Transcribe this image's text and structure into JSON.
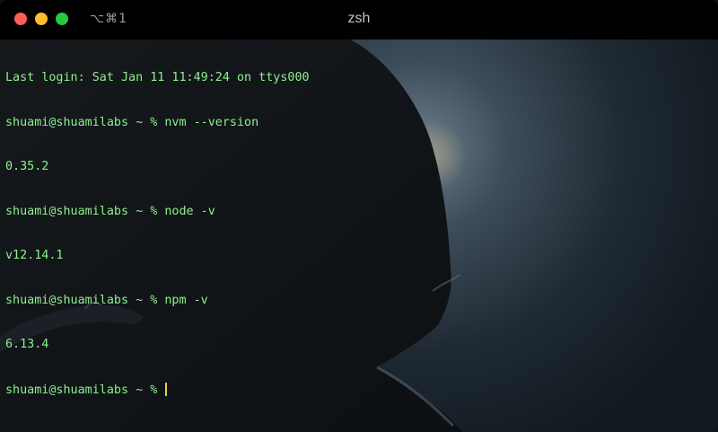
{
  "window": {
    "title": "zsh",
    "shortcut": "⌥⌘1"
  },
  "colors": {
    "prompt_text": "#8ef08e",
    "cursor": "#f5c64a",
    "titlebar": "#000000",
    "close": "#ff5f57",
    "minimize": "#febc2e",
    "zoom": "#28c840"
  },
  "icons": [
    "close-button",
    "minimize-button",
    "zoom-button"
  ],
  "terminal": {
    "lines": [
      "Last login: Sat Jan 11 11:49:24 on ttys000",
      "shuami@shuamilabs ~ % nvm --version",
      "0.35.2",
      "shuami@shuamilabs ~ % node -v",
      "v12.14.1",
      "shuami@shuamilabs ~ % npm -v",
      "6.13.4"
    ],
    "current_prompt": "shuami@shuamilabs ~ % "
  }
}
